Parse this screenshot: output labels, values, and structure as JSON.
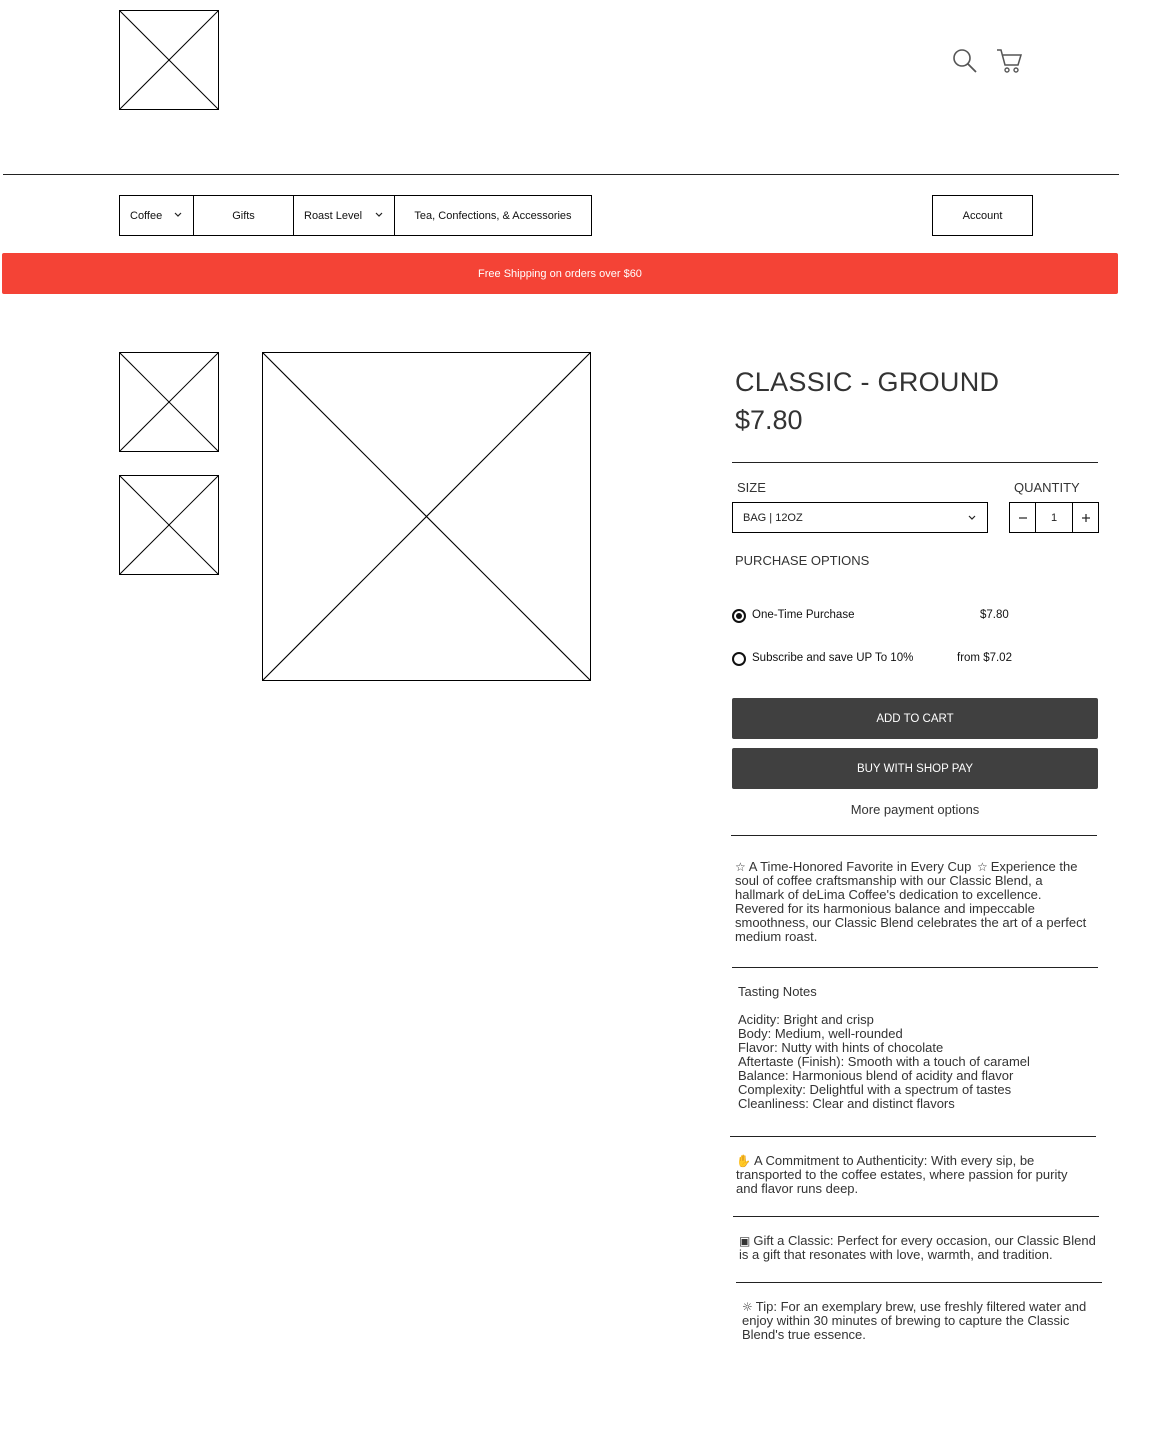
{
  "header": {
    "logo_icon": "image-placeholder-icon",
    "search_icon": "search-icon",
    "cart_icon": "cart-icon"
  },
  "nav": {
    "items": [
      {
        "label": "Coffee",
        "has_dropdown": true
      },
      {
        "label": "Gifts",
        "has_dropdown": false
      },
      {
        "label": "Roast Level",
        "has_dropdown": true
      },
      {
        "label": "Tea, Confections, & Accessories",
        "has_dropdown": false
      }
    ],
    "account_label": "Account"
  },
  "banner": {
    "text": "Free Shipping on orders over $60",
    "color": "#f44336"
  },
  "product": {
    "title": "CLASSIC - GROUND",
    "price": "$7.80",
    "size_label": "SIZE",
    "size_value": "BAG | 12OZ",
    "quantity_label": "QUANTITY",
    "quantity_value": "1",
    "purchase_options_label": "PURCHASE OPTIONS",
    "options": [
      {
        "label": "One-Time Purchase",
        "price": "$7.80",
        "selected": true
      },
      {
        "label": "Subscribe and save UP To 10%",
        "price": "from $7.02",
        "selected": false
      }
    ],
    "add_to_cart": "ADD TO CART",
    "buy_with_shop_pay": "BUY WITH SHOP PAY",
    "more_payment_options": "More payment options"
  },
  "description": {
    "intro_lines": [
      "A Time-Honored Favorite in Every Cup",
      "Experience the",
      "soul of coffee craftsmanship with our Classic Blend, a",
      "hallmark of deLima Coffee's dedication to excellence.",
      "Revered for its harmonious balance and impeccable",
      "smoothness, our Classic Blend celebrates the art of a perfect",
      "medium roast."
    ],
    "tasting_title": "Tasting Notes",
    "tasting_notes": [
      "Acidity: Bright and crisp",
      "Body: Medium, well-rounded",
      "Flavor: Nutty with hints of chocolate",
      "Aftertaste (Finish): Smooth with a touch of caramel",
      "Balance: Harmonious blend of acidity and flavor",
      "Complexity: Delightful with a spectrum of tastes",
      "Cleanliness: Clear and distinct flavors"
    ],
    "authenticity_lines": [
      "A Commitment to Authenticity: With every sip, be",
      "transported to the coffee estates, where passion for purity",
      "and flavor runs deep."
    ],
    "gift_lines": [
      "Gift a Classic: Perfect for every occasion, our Classic Blend",
      "is a gift that resonates with love, warmth, and tradition."
    ],
    "tip_lines": [
      "Tip: For an exemplary brew, use freshly filtered water and",
      "enjoy within 30 minutes of brewing to capture the Classic",
      "Blend's true essence."
    ]
  }
}
